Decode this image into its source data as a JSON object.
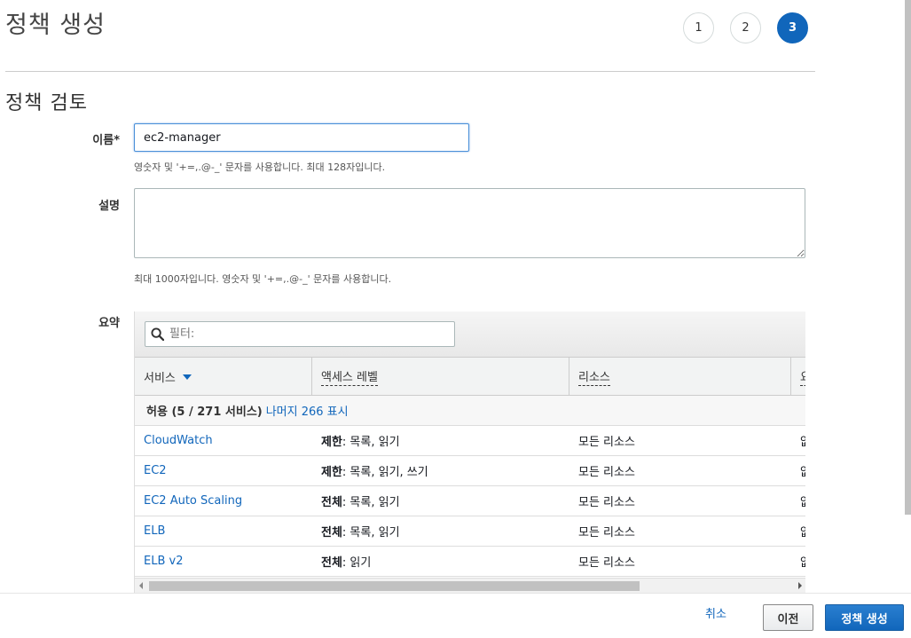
{
  "page_title": "정책 생성",
  "steps": [
    "1",
    "2",
    "3"
  ],
  "active_step": "3",
  "section_title": "정책 검토",
  "form": {
    "name_label": "이름*",
    "name_value": "ec2-manager",
    "name_hint": "영숫자 및 '+=,.@-_' 문자를 사용합니다. 최대 128자입니다.",
    "desc_label": "설명",
    "desc_value": "",
    "desc_hint": "최대 1000자입니다. 영숫자 및 '+=,.@-_' 문자를 사용합니다.",
    "summary_label": "요약"
  },
  "summary": {
    "filter_placeholder": "필터:",
    "columns": [
      "서비스",
      "액세스 레벨",
      "리소스",
      "요"
    ],
    "group": {
      "prefix": "허용 (5 / 271 서비스)",
      "link": "나머지 266 표시"
    },
    "rows": [
      {
        "service": "CloudWatch",
        "level_bold": "제한",
        "level_rest": ": 목록, 읽기",
        "resource": "모든 리소스",
        "extra": "없"
      },
      {
        "service": "EC2",
        "level_bold": "제한",
        "level_rest": ": 목록, 읽기, 쓰기",
        "resource": "모든 리소스",
        "extra": "없"
      },
      {
        "service": "EC2 Auto Scaling",
        "level_bold": "전체",
        "level_rest": ": 목록, 읽기",
        "resource": "모든 리소스",
        "extra": "없"
      },
      {
        "service": "ELB",
        "level_bold": "전체",
        "level_rest": ": 목록, 읽기",
        "resource": "모든 리소스",
        "extra": "없"
      },
      {
        "service": "ELB v2",
        "level_bold": "전체",
        "level_rest": ": 읽기",
        "resource": "모든 리소스",
        "extra": "없"
      }
    ]
  },
  "footer": {
    "cancel": "취소",
    "previous": "이전",
    "create": "정책 생성"
  },
  "colors": {
    "accent": "#1166bb",
    "link": "#1166bb"
  }
}
